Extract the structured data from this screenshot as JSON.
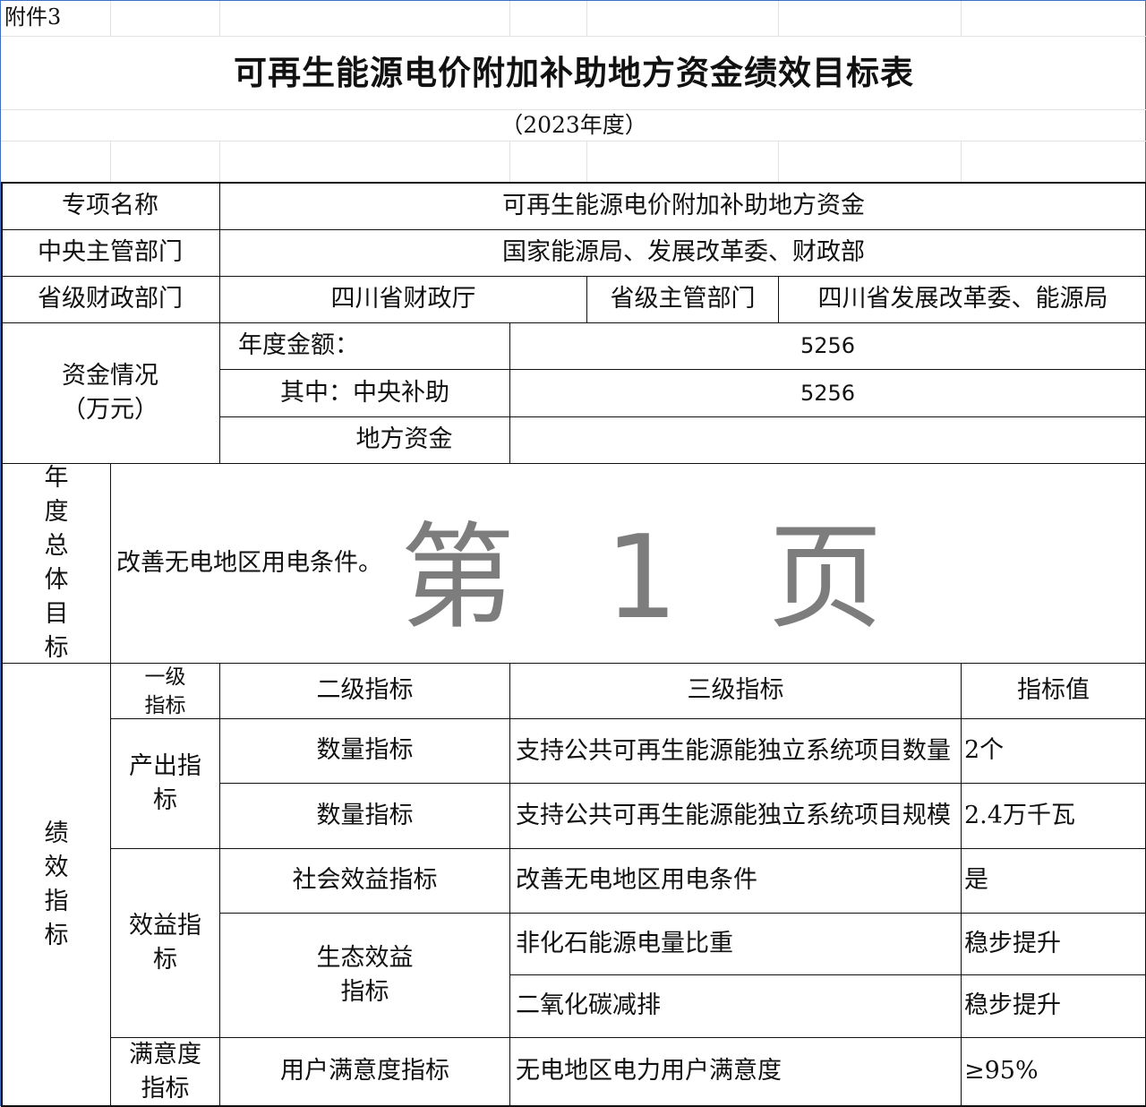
{
  "attachment_label": "附件3",
  "title": "可再生能源电价附加补助地方资金绩效目标表",
  "year_note": "（2023年度）",
  "info": {
    "project_name_label": "专项名称",
    "project_name_value": "可再生能源电价附加补助地方资金",
    "central_dept_label": "中央主管部门",
    "central_dept_value": "国家能源局、发展改革委、财政部",
    "prov_finance_label": "省级财政部门",
    "prov_finance_value": "四川省财政厅",
    "prov_dept_label": "省级主管部门",
    "prov_dept_value": "四川省发展改革委、能源局"
  },
  "funds": {
    "label_line1": "资金情况",
    "label_line2": "（万元）",
    "annual_label": "年度金额：",
    "annual_value": "5256",
    "central_label": "其中：中央补助",
    "central_value": "5256",
    "local_label": "地方资金",
    "local_value": ""
  },
  "goal": {
    "label_chars": [
      "年",
      "度",
      "总",
      "体",
      "目",
      "标"
    ],
    "text": "改善无电地区用电条件。"
  },
  "watermark": "第 1 页",
  "indicators": {
    "side_label_chars": [
      "绩",
      "效",
      "指",
      "标"
    ],
    "headers": {
      "level1_line1": "一级",
      "level1_line2": "指标",
      "level2": "二级指标",
      "level3": "三级指标",
      "value": "指标值"
    },
    "output_label_line1": "产出指",
    "output_label_line2": "标",
    "benefit_label_line1": "效益指",
    "benefit_label_line2": "标",
    "satisfaction_label_line1": "满意度",
    "satisfaction_label_line2": "指标",
    "eco_label_line1": "生态效益",
    "eco_label_line2": "指标",
    "rows": [
      {
        "level2": "数量指标",
        "level3": "支持公共可再生能源能独立系统项目数量",
        "value": "2个"
      },
      {
        "level2": "数量指标",
        "level3": "支持公共可再生能源能独立系统项目规模",
        "value": "2.4万千瓦"
      },
      {
        "level2": "社会效益指标",
        "level3": "改善无电地区用电条件",
        "value": "是"
      },
      {
        "level2": "",
        "level3": "非化石能源电量比重",
        "value": "稳步提升"
      },
      {
        "level2": "",
        "level3": "二氧化碳减排",
        "value": "稳步提升"
      },
      {
        "level2": "用户满意度指标",
        "level3": "无电地区电力用户满意度",
        "value": "≥95%"
      }
    ]
  }
}
